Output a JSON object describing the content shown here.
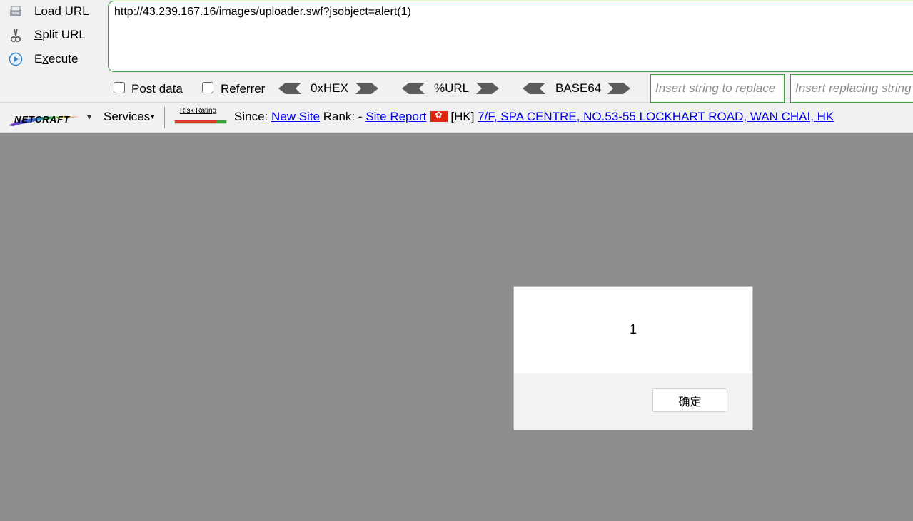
{
  "hackbar": {
    "commands": {
      "load": {
        "prefix": "Lo",
        "key": "a",
        "suffix": "d URL"
      },
      "split": {
        "key": "S",
        "suffix": "plit URL"
      },
      "execute": {
        "prefix": "E",
        "key": "x",
        "suffix": "ecute"
      }
    },
    "url_value": "http://43.239.167.16/images/uploader.swf?jsobject=alert(1)",
    "post_data_label": "Post data",
    "referrer_label": "Referrer",
    "post_data_checked": false,
    "referrer_checked": false,
    "encoders": [
      "0xHEX",
      "%URL",
      "BASE64"
    ],
    "replace_placeholder": "Insert string to replace",
    "replacing_placeholder": "Insert replacing string"
  },
  "netcraft": {
    "logo_text": "NETCRAFT",
    "services_label": "Services",
    "risk_label": "Risk Rating",
    "since_label": "Since:",
    "since_value": "New Site",
    "rank_label": "Rank:",
    "rank_value": "-",
    "site_report": "Site Report",
    "country": "[HK]",
    "address": "7/F, SPA CENTRE, NO.53-55 LOCKHART ROAD, WAN CHAI, HK"
  },
  "alert": {
    "message": "1",
    "ok_label": "确定"
  },
  "colors": {
    "accent_green": "#3f9d3f",
    "link_blue": "#0000ee",
    "page_gray": "#8c8d8e"
  }
}
